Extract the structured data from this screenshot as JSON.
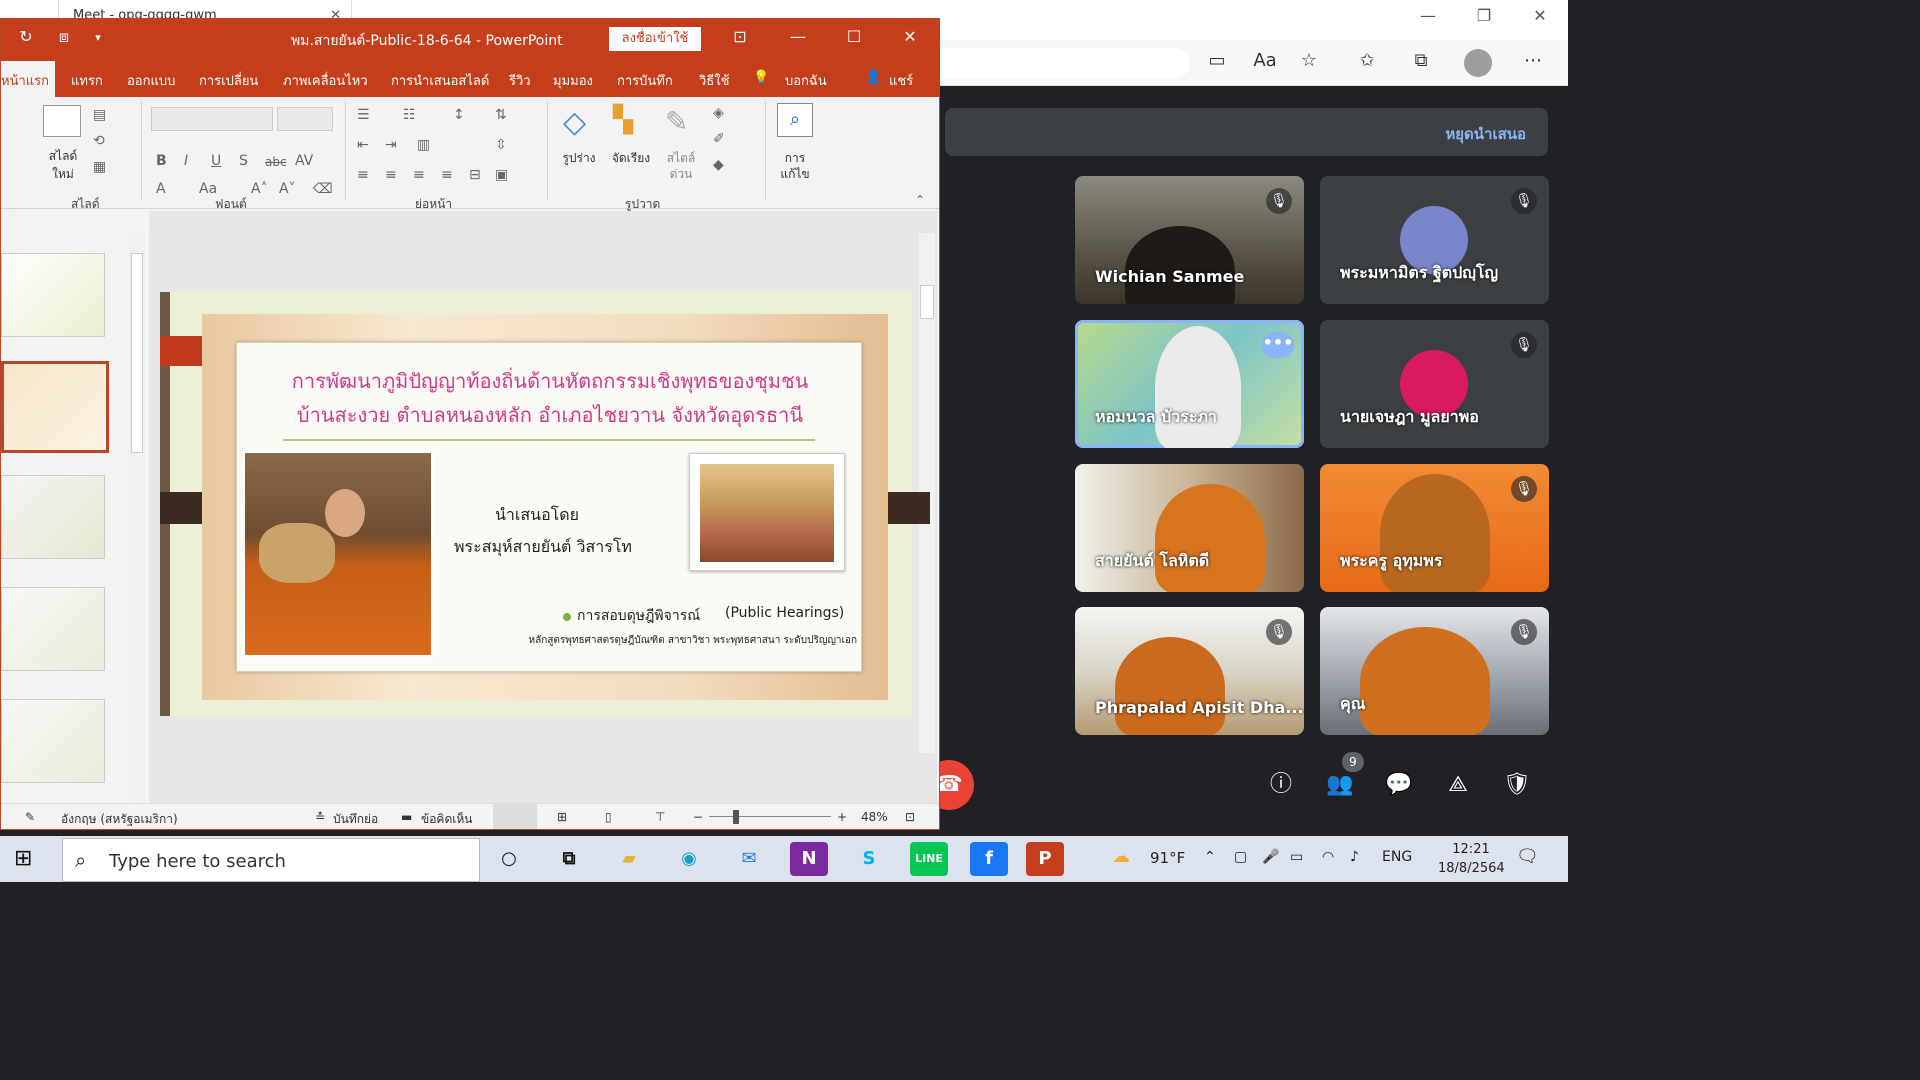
{
  "browser": {
    "tab_title": "Meet - opq-gqgq-gwm",
    "minimize": "—",
    "restore": "❐",
    "close": "✕",
    "icons": [
      "camera-icon",
      "read-aloud-icon",
      "add-favorite-icon",
      "favorites-icon",
      "collections-icon",
      "profile-icon",
      "more-icon"
    ]
  },
  "meet": {
    "stop_presenting": "หยุดนำเสนอ",
    "participants": [
      {
        "name": "Wichian Sanmee",
        "muted": true
      },
      {
        "name": "พระมหามิตร ฐิตปญฺโญ",
        "muted": true,
        "avatar_color": "#7986cb"
      },
      {
        "name": "หอมนวล บัวระภา",
        "muted": false,
        "speaking_menu": "•••"
      },
      {
        "name": "นายเจษฎา มูลยาพอ",
        "muted": true,
        "avatar_color": "#d81b60"
      },
      {
        "name": "สายยันต์ โลหิตดี",
        "muted": false
      },
      {
        "name": "พระครู อุทุมพร",
        "muted": true
      },
      {
        "name": "Phrapalad Apisit Dha...",
        "muted": true
      },
      {
        "name": "คุณ",
        "muted": true
      }
    ],
    "people_count": "9",
    "controls": [
      "info-icon",
      "people-icon",
      "chat-icon",
      "activities-icon",
      "host-controls-icon"
    ]
  },
  "powerpoint": {
    "title": "พม.สายยันต์-Public-18-6-64  -  PowerPoint",
    "sign_in": "ลงชื่อเข้าใช้",
    "tabs": [
      "หน้าแรก",
      "แทรก",
      "ออกแบบ",
      "การเปลี่ยน",
      "ภาพเคลื่อนไหว",
      "การนำเสนอสไลด์",
      "รีวิว",
      "มุมมอง",
      "การบันทึก",
      "วิธีใช้",
      "บอกฉัน",
      "แชร์"
    ],
    "ribbon": {
      "new_slide_1": "สไลด์",
      "new_slide_2": "ใหม่",
      "group_slides": "สไลด์",
      "group_font": "ฟอนต์",
      "group_paragraph": "ย่อหน้า",
      "group_drawing": "รูปวาด",
      "shapes": "รูปร่าง",
      "arrange": "จัดเรียง",
      "quick_styles_1": "สไตล์",
      "quick_styles_2": "ด่วน",
      "editing_1": "การ",
      "editing_2": "แก้ไข"
    },
    "slide": {
      "title_line1": "การพัฒนาภูมิปัญญาท้องถิ่นด้านหัตถกรรมเชิงพุทธของชุมชน",
      "title_line2": "บ้านสะงวย ตำบลหนองหลัก อำเภอไชยวาน จังหวัดอุดรธานี",
      "presented_by": "นำเสนอโดย",
      "presenter": "พระสมุห์สายยันต์ วิสารโท",
      "hearing": "การสอบดุษฎีพิจารณ์",
      "hearing_en": "(Public Hearings)",
      "program": "หลักสูตรพุทธศาสตรดุษฎีบัณฑิต สาขาวิชา พระพุทธศาสนา ระดับปริญญาเอก"
    },
    "status": {
      "language": "อังกฤษ (สหรัฐอเมริกา)",
      "notes": "บันทึกย่อ",
      "comments": "ข้อคิดเห็น",
      "zoom": "48%"
    }
  },
  "taskbar": {
    "search_placeholder": "Type here to search",
    "temperature": "91°F",
    "language": "ENG",
    "time": "12:21",
    "date": "18/8/2564"
  }
}
